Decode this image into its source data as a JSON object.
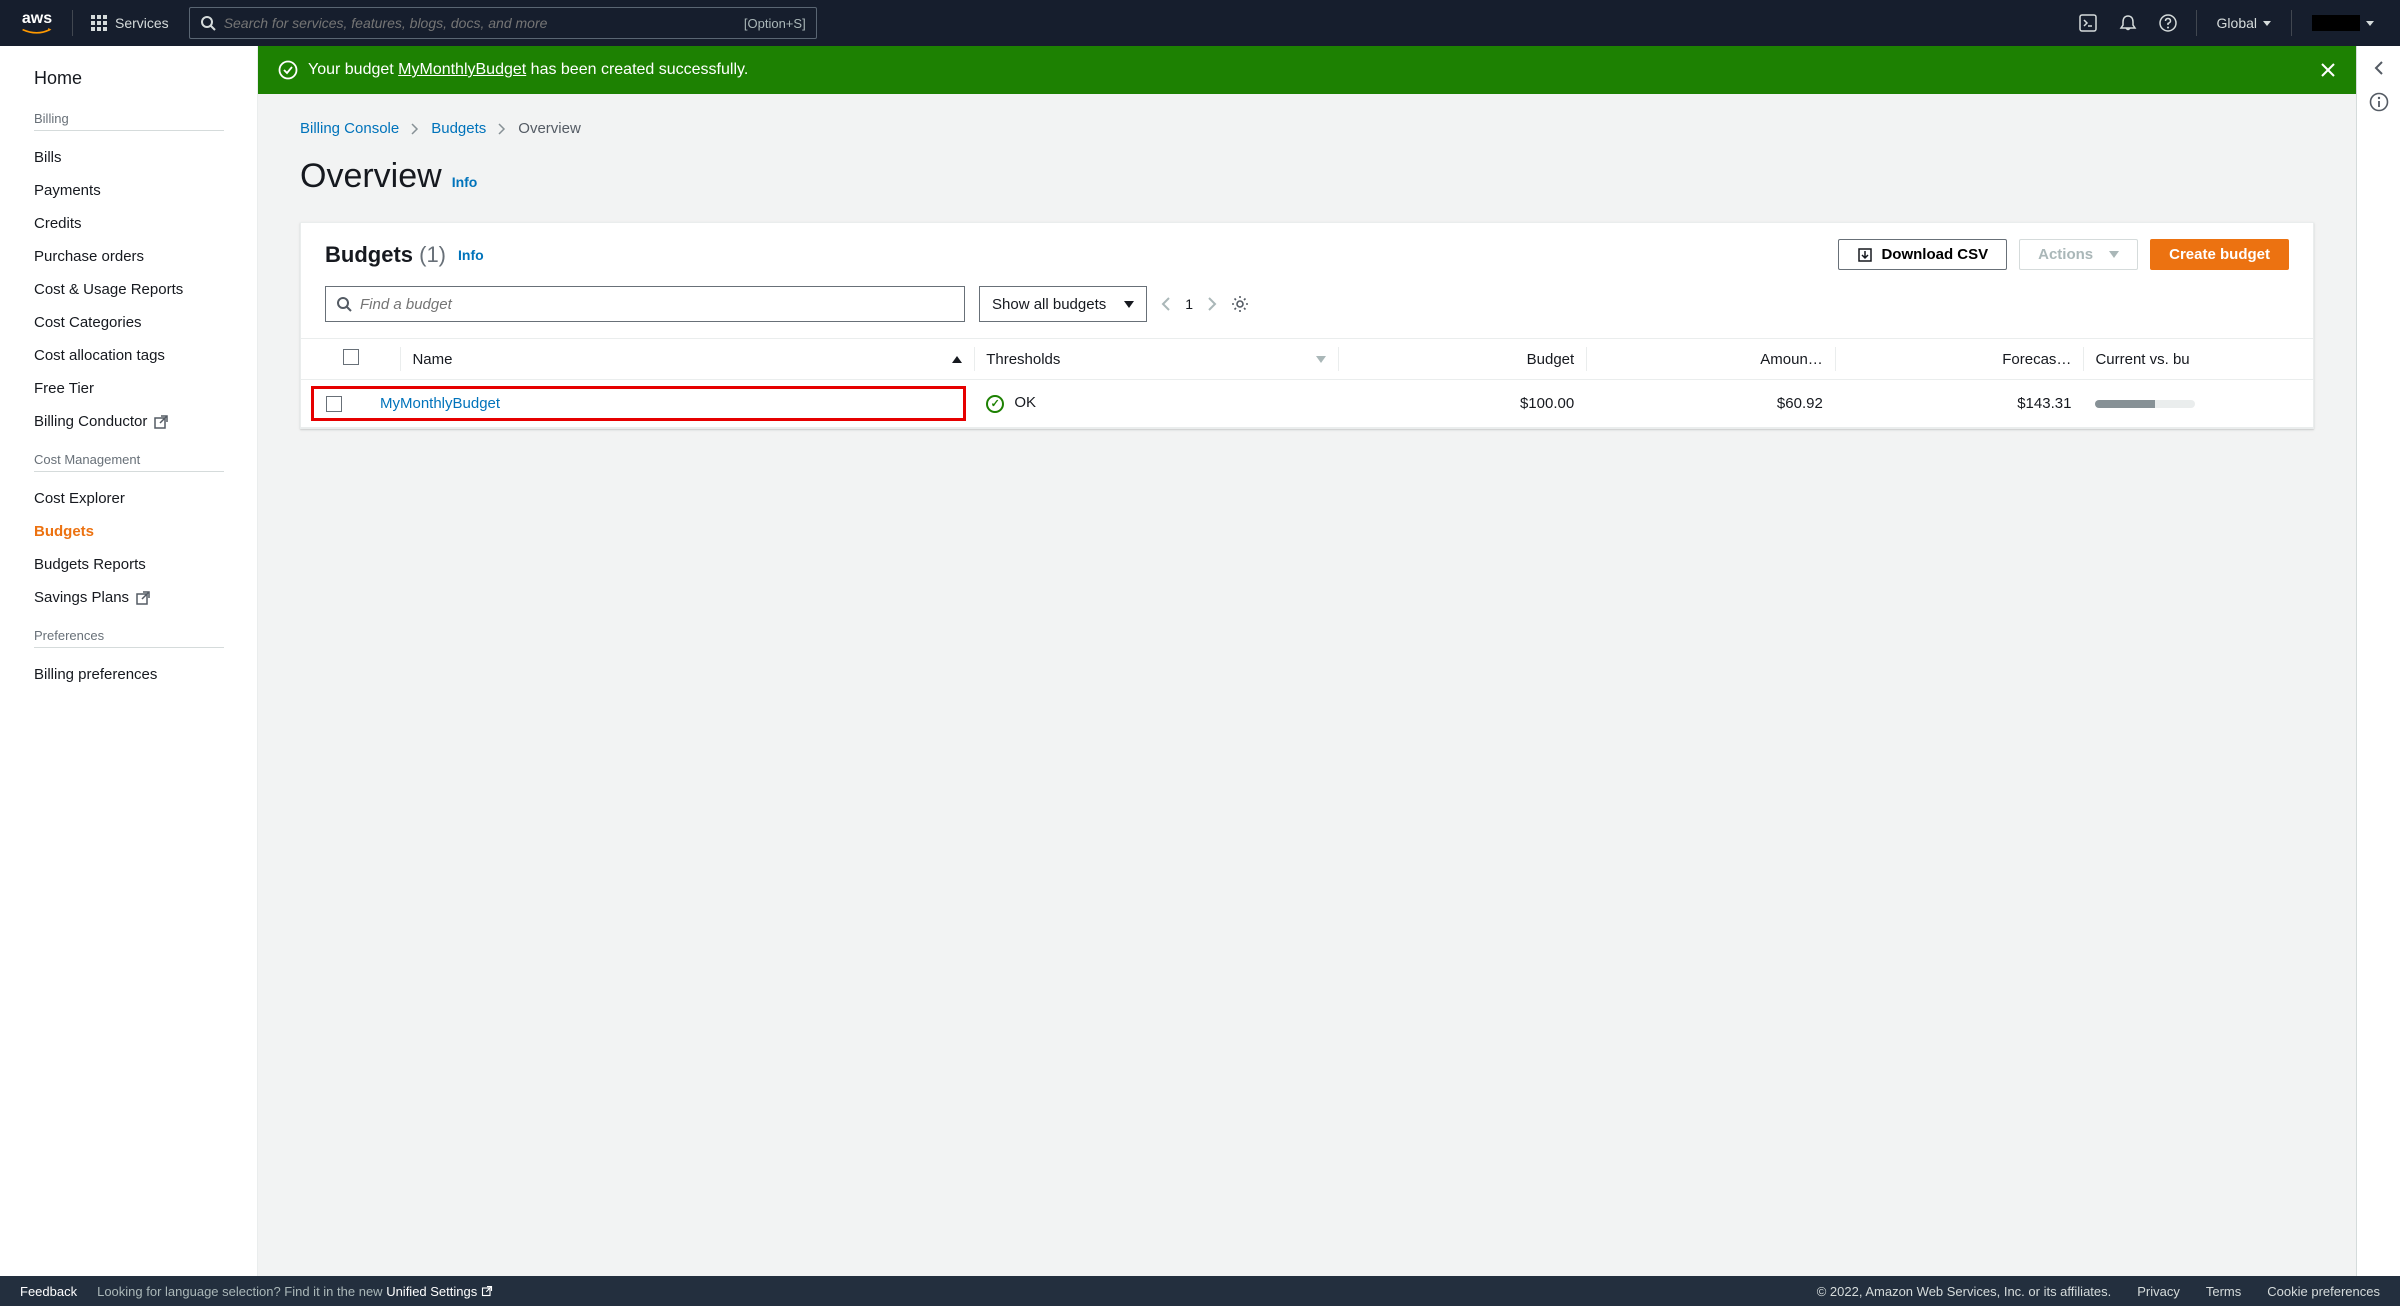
{
  "header": {
    "logo_text": "aws",
    "services_label": "Services",
    "search_placeholder": "Search for services, features, blogs, docs, and more",
    "search_shortcut": "[Option+S]",
    "region_label": "Global"
  },
  "sidebar": {
    "home": "Home",
    "groups": [
      {
        "header": "Billing",
        "items": [
          {
            "label": "Bills",
            "active": false,
            "external": false
          },
          {
            "label": "Payments",
            "active": false,
            "external": false
          },
          {
            "label": "Credits",
            "active": false,
            "external": false
          },
          {
            "label": "Purchase orders",
            "active": false,
            "external": false
          },
          {
            "label": "Cost & Usage Reports",
            "active": false,
            "external": false
          },
          {
            "label": "Cost Categories",
            "active": false,
            "external": false
          },
          {
            "label": "Cost allocation tags",
            "active": false,
            "external": false
          },
          {
            "label": "Free Tier",
            "active": false,
            "external": false
          },
          {
            "label": "Billing Conductor",
            "active": false,
            "external": true
          }
        ]
      },
      {
        "header": "Cost Management",
        "items": [
          {
            "label": "Cost Explorer",
            "active": false,
            "external": false
          },
          {
            "label": "Budgets",
            "active": true,
            "external": false
          },
          {
            "label": "Budgets Reports",
            "active": false,
            "external": false
          },
          {
            "label": "Savings Plans",
            "active": false,
            "external": true
          }
        ]
      },
      {
        "header": "Preferences",
        "items": [
          {
            "label": "Billing preferences",
            "active": false,
            "external": false
          }
        ]
      }
    ]
  },
  "flash": {
    "prefix": "Your budget ",
    "link": "MyMonthlyBudget",
    "suffix": " has been created successfully."
  },
  "breadcrumb": {
    "items": [
      "Billing Console",
      "Budgets",
      "Overview"
    ]
  },
  "page": {
    "title": "Overview",
    "info": "Info"
  },
  "panel": {
    "title": "Budgets",
    "count": "(1)",
    "info": "Info",
    "download_label": "Download CSV",
    "actions_label": "Actions",
    "create_label": "Create budget",
    "find_placeholder": "Find a budget",
    "filter_label": "Show all budgets",
    "page_number": "1"
  },
  "table": {
    "columns": {
      "name": "Name",
      "thresholds": "Thresholds",
      "budget": "Budget",
      "amount": "Amoun…",
      "forecast": "Forecas…",
      "current": "Current vs. bu"
    },
    "rows": [
      {
        "name": "MyMonthlyBudget",
        "threshold_status": "OK",
        "budget": "$100.00",
        "amount": "$60.92",
        "forecast": "$143.31"
      }
    ]
  },
  "footer": {
    "feedback": "Feedback",
    "lang_prefix": "Looking for language selection? Find it in the new ",
    "lang_link": "Unified Settings",
    "copyright": "© 2022, Amazon Web Services, Inc. or its affiliates.",
    "privacy": "Privacy",
    "terms": "Terms",
    "cookies": "Cookie preferences"
  }
}
